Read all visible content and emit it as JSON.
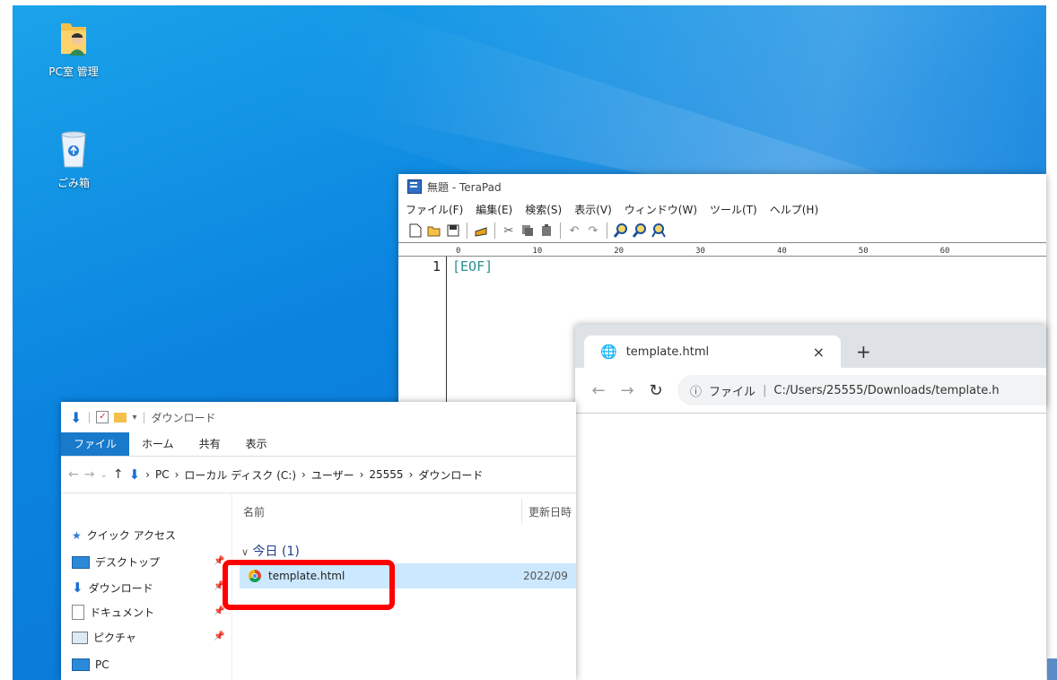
{
  "desktop": {
    "icons": [
      {
        "label": "PC室 管理",
        "icon": "user-folder-icon"
      },
      {
        "label": "ごみ箱",
        "icon": "recycle-bin-icon"
      }
    ]
  },
  "terapad": {
    "title": "無題 - TeraPad",
    "menu": [
      "ファイル(F)",
      "編集(E)",
      "検索(S)",
      "表示(V)",
      "ウィンドウ(W)",
      "ツール(T)",
      "ヘルプ(H)"
    ],
    "ruler": [
      "0",
      "10",
      "20",
      "30",
      "40",
      "50",
      "60"
    ],
    "line_number": "1",
    "eof": "[EOF]"
  },
  "chrome": {
    "tab_title": "template.html",
    "close_glyph": "×",
    "new_tab_glyph": "+",
    "address_scheme": "ファイル",
    "address_url": "C:/Users/25555/Downloads/template.h"
  },
  "explorer": {
    "title": "ダウンロード",
    "ribbon_tabs": [
      "ファイル",
      "ホーム",
      "共有",
      "表示"
    ],
    "breadcrumb": [
      "PC",
      "ローカル ディスク (C:)",
      "ユーザー",
      "25555",
      "ダウンロード"
    ],
    "nav": {
      "quick_access": "クイック アクセス",
      "items": [
        "デスクトップ",
        "ダウンロード",
        "ドキュメント",
        "ピクチャ"
      ],
      "pc": "PC"
    },
    "columns": {
      "name": "名前",
      "modified": "更新日時"
    },
    "group": "今日 (1)",
    "file": {
      "name": "template.html",
      "date": "2022/09"
    }
  },
  "colors": {
    "highlight": "#ff0000",
    "ribbon_file": "#1979ca",
    "selection": "#cce8ff"
  }
}
